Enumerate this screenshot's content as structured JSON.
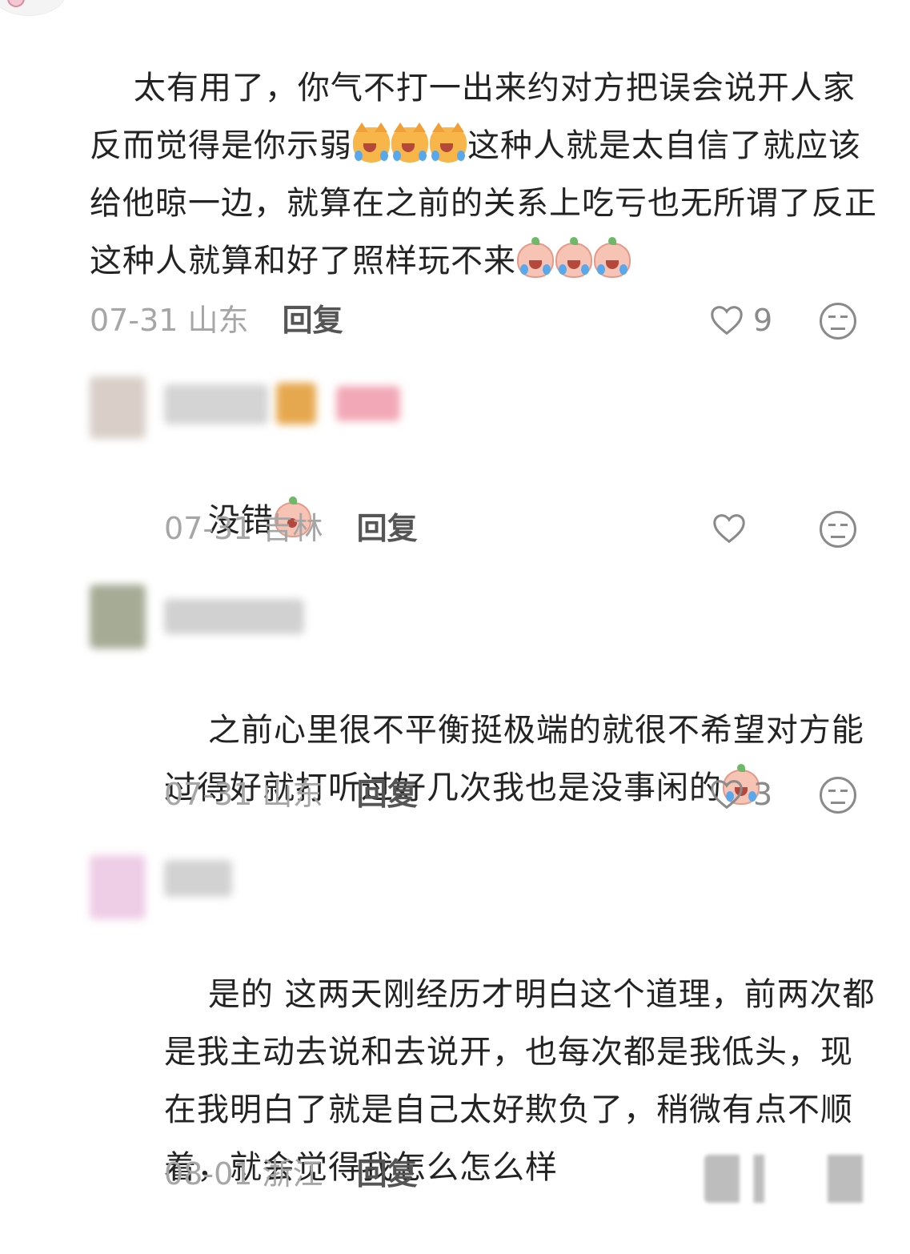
{
  "comments": [
    {
      "text_1": "太有用了，你气不打一出来约对方把误会说开人家反而觉得是你示弱",
      "emoji_1": [
        "laughing-cat-emoji",
        "laughing-cat-emoji",
        "laughing-cat-emoji"
      ],
      "text_2": "这种人就是太自信了就应该给他晾一边，就算在之前的关系上吃亏也无所谓了反正这种人就算和好了照样玩不来",
      "emoji_2": [
        "crying-peach-emoji",
        "crying-peach-emoji",
        "crying-peach-emoji"
      ],
      "date": "07-31",
      "location": "山东",
      "reply_label": "回复",
      "likes": "9"
    },
    {
      "text_1": "没错",
      "emoji_1": [
        "peach-emoji"
      ],
      "date": "07-31",
      "location": "吉林",
      "reply_label": "回复",
      "likes": ""
    },
    {
      "text_1": "之前心里很不平衡挺极端的就很不希望对方能过得好就打听过好几次我也是没事闲的",
      "emoji_1": [
        "crying-peach-emoji"
      ],
      "date": "07-31",
      "location": "山东",
      "reply_label": "回复",
      "likes": "3"
    },
    {
      "text_1": "是的 这两天刚经历才明白这个道理，前两次都是我主动去说和去说开，也每次都是我低头，现在我明白了就是自己太好欺负了，稍微有点不顺着，就会觉得我怎么怎么样",
      "date": "08-01",
      "location": "浙江",
      "reply_label": "回复"
    }
  ],
  "colors": {
    "text": "#232323",
    "meta": "#a6a6a6",
    "reply": "#555555",
    "icon": "#8a8a8a"
  }
}
